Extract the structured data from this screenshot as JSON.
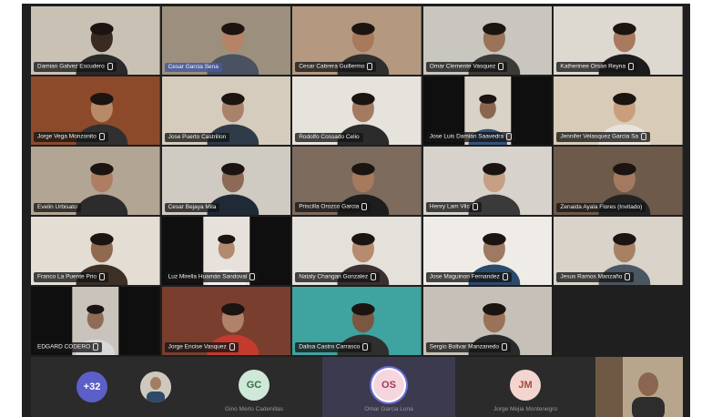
{
  "tiles": [
    {
      "name": "Damian Galvez Escudero",
      "bg": "#c9c2b4",
      "skin": "#3a2b22",
      "shirt": "#2a2a2a",
      "muted": true
    },
    {
      "name": "Cesar Garcia Sena",
      "bg": "#9c8f7d",
      "skin": "#b58466",
      "shirt": "#4a5160",
      "muted": false,
      "hl": true
    },
    {
      "name": "Cesar Cabrera Guillermo",
      "bg": "#b49980",
      "skin": "#a9795c",
      "shirt": "#2e2e2e",
      "muted": true
    },
    {
      "name": "Omar Clemente Vasquez",
      "bg": "#c9c6bf",
      "skin": "#9a7358",
      "shirt": "#3c3a36",
      "muted": true
    },
    {
      "name": "Katherinee Orsan Reyna",
      "bg": "#ddd9d1",
      "skin": "#a87a5e",
      "shirt": "#1c1c1c",
      "muted": true
    },
    {
      "name": "Jorge Vega Monzonito",
      "bg": "#8d4a2b",
      "skin": "#b98a68",
      "shirt": "#303030",
      "muted": true
    },
    {
      "name": "Jose Puerto Castrillon",
      "bg": "#d6ccbd",
      "skin": "#a9826a",
      "shirt": "#2f3b48",
      "muted": false
    },
    {
      "name": "Rodolfo Cossado Celio",
      "bg": "#e6e2dc",
      "skin": "#a47b60",
      "shirt": "#2b2b2b",
      "muted": false
    },
    {
      "name": "Jose Luis Damian Saavedra",
      "bg": "#0f0f0f",
      "skin": "#8a6650",
      "shirt": "#36537a",
      "muted": true,
      "inset": true,
      "insetbg": "#d9d2c6"
    },
    {
      "name": "Jennifer Velasquez Garcia Sa",
      "bg": "#d8cbb7",
      "skin": "#c99e7d",
      "shirt": "#e8e3da",
      "muted": true
    },
    {
      "name": "Evelin Urbisato",
      "bg": "#b3a594",
      "skin": "#ae7e62",
      "shirt": "#2c2c2c",
      "muted": false
    },
    {
      "name": "Cesar Bejaya Mila",
      "bg": "#cfcac2",
      "skin": "#8c6a55",
      "shirt": "#1f2a36",
      "muted": false
    },
    {
      "name": "Priscilla Orozco Garcia",
      "bg": "#7d6b5e",
      "skin": "#a77a5e",
      "shirt": "#1d1d1d",
      "muted": true
    },
    {
      "name": "Henry Lam Vilc",
      "bg": "#d7d2cc",
      "skin": "#c79f84",
      "shirt": "#3a3a3a",
      "muted": true
    },
    {
      "name": "Zenaida Ayala Flores (Invitado)",
      "bg": "#6d5a4a",
      "skin": "#a37a60",
      "shirt": "#232323",
      "muted": false
    },
    {
      "name": "Franco La Puente Prio",
      "bg": "#e3ddd4",
      "skin": "#8f6a4f",
      "shirt": "#3b2f26",
      "muted": true
    },
    {
      "name": "Luz Mirella Huamán Sandoval",
      "bg": "#0f0f0f",
      "skin": "#b18a70",
      "shirt": "#efefef",
      "muted": true,
      "inset": true,
      "insetbg": "#e6e1da"
    },
    {
      "name": "Nataly Changan Gonzalez",
      "bg": "#e4e0da",
      "skin": "#b78b6f",
      "shirt": "#3a3030",
      "muted": true
    },
    {
      "name": "Jose Maguinon Fernandez",
      "bg": "#efece8",
      "skin": "#9f7a62",
      "shirt": "#2b4a6b",
      "muted": true
    },
    {
      "name": "Jesus Ramos Manzaño",
      "bg": "#d9d3ca",
      "skin": "#a88165",
      "shirt": "#4a5661",
      "muted": true
    },
    {
      "name": "EDGARD CODERO",
      "bg": "#0f0f0f",
      "skin": "#8f6c55",
      "shirt": "#d8d8d8",
      "muted": true,
      "inset": true,
      "insetbg": "#c9c3bb"
    },
    {
      "name": "Jorge Encise Vasquez",
      "bg": "#7a3e2e",
      "skin": "#b0826a",
      "shirt": "#c33a2e",
      "muted": true
    },
    {
      "name": "Dalisa Castro Carrasco",
      "bg": "#3fa3a0",
      "skin": "#7b5640",
      "shirt": "#2f2f2f",
      "muted": true
    },
    {
      "name": "Sergio Bolivar Manzanedo",
      "bg": "#c6c0b8",
      "skin": "#9a7258",
      "shirt": "#2a2a2a",
      "muted": true
    }
  ],
  "bottom_bar": {
    "overflow_count": "+32",
    "overflow_color": "#5b5fc7",
    "participants": [
      {
        "initials": "GC",
        "name": "Gino Merlo Cadenillas",
        "color": "#cfe8d8",
        "text_color": "#3a6b4e"
      },
      {
        "initials": "OS",
        "name": "Omar Garcia Luna",
        "color": "#f6d6de",
        "text_color": "#a03a5a",
        "active": true
      },
      {
        "initials": "JM",
        "name": "Jorge Mejia Montenegro",
        "color": "#f3d5d0",
        "text_color": "#a34a3a"
      }
    ]
  }
}
